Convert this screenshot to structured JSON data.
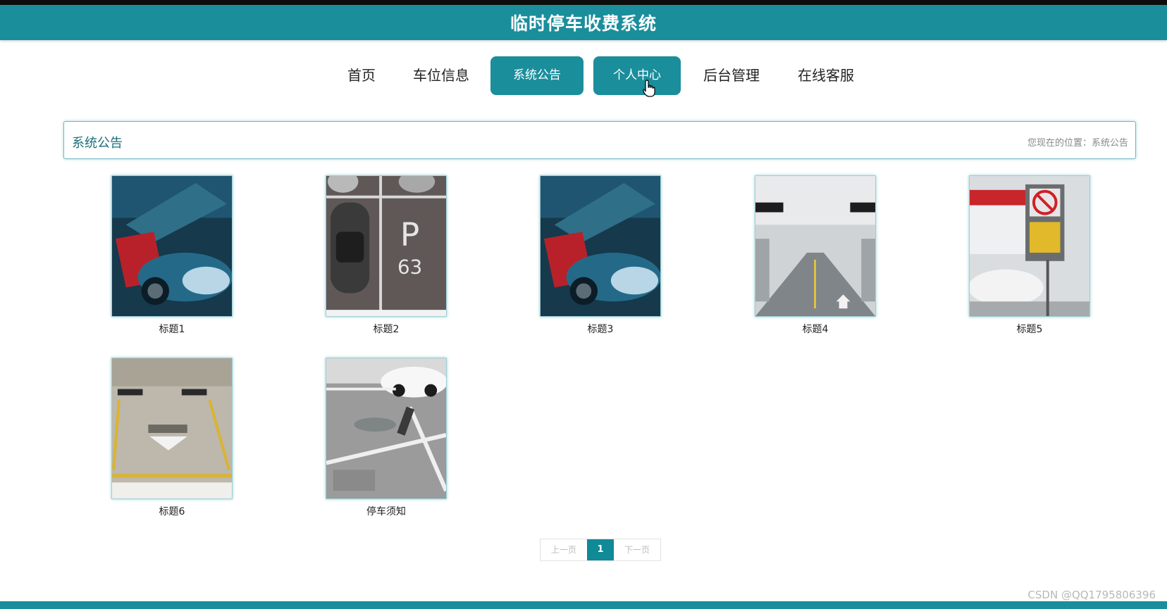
{
  "header": {
    "title": "临时停车收费系统"
  },
  "nav": {
    "items": [
      {
        "label": "首页"
      },
      {
        "label": "车位信息"
      },
      {
        "label": "系统公告"
      },
      {
        "label": "个人中心"
      },
      {
        "label": "后台管理"
      },
      {
        "label": "在线客服"
      }
    ]
  },
  "panel": {
    "title": "系统公告",
    "breadcrumb": "您现在的位置：系统公告"
  },
  "cards": [
    {
      "caption": "标题1",
      "image": "blue-sports-car"
    },
    {
      "caption": "标题2",
      "image": "parking-lot-p63"
    },
    {
      "caption": "标题3",
      "image": "blue-sports-car"
    },
    {
      "caption": "标题4",
      "image": "underground-garage"
    },
    {
      "caption": "标题5",
      "image": "no-parking-sign"
    },
    {
      "caption": "标题6",
      "image": "parking-space-marking"
    },
    {
      "caption": "停车须知",
      "image": "parking-lock-space"
    }
  ],
  "pagination": {
    "prev": "上一页",
    "current": "1",
    "next": "下一页"
  },
  "watermark": "CSDN @QQ1795806396",
  "colors": {
    "primary": "#1b8e9c",
    "top_strip": "#0d0d0d"
  }
}
